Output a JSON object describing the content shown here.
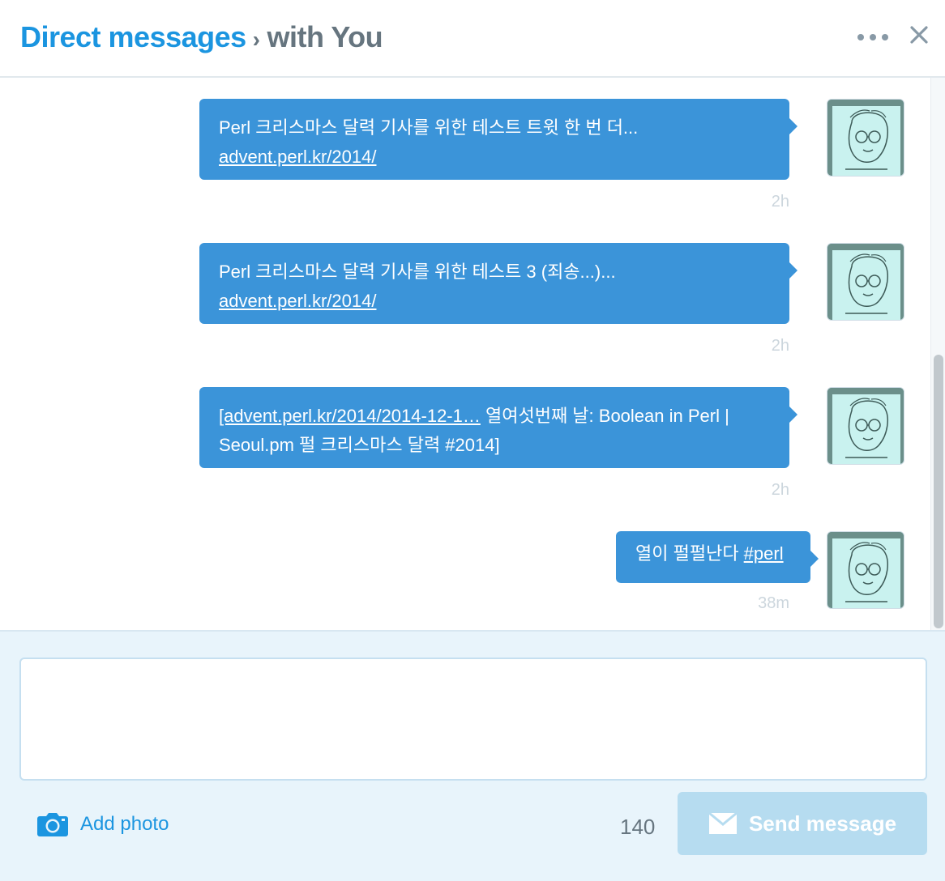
{
  "header": {
    "title": "Direct messages",
    "separator": "›",
    "subtitle": "with You"
  },
  "icons": {
    "more": "more-horizontal-icon",
    "close": "close-icon",
    "camera": "camera-icon",
    "envelope": "envelope-icon"
  },
  "colors": {
    "accent": "#1b95e0",
    "bubble": "#3b94d9",
    "send_disabled": "#b6dcf0"
  },
  "messages": [
    {
      "text": "Perl 크리스마스 달력 기사를 위한 테스트 트윗 한 번 더...",
      "link": "advent.perl.kr/2014/",
      "time": "2h"
    },
    {
      "text": "Perl 크리스마스 달력 기사를 위한 테스트 3 (죄송...)...",
      "link": "advent.perl.kr/2014/",
      "time": "2h"
    },
    {
      "link": "[advent.perl.kr/2014/2014-12-1…",
      "text": " 열여섯번째 날: Boolean in Perl | Seoul.pm 펄 크리스마스 달력 #2014]",
      "time": "2h"
    },
    {
      "text": "열이 펄펄난다 ",
      "hashtag": "#perl",
      "time": "38m"
    }
  ],
  "composer": {
    "add_photo": "Add photo",
    "char_count": "140",
    "send": "Send message"
  }
}
